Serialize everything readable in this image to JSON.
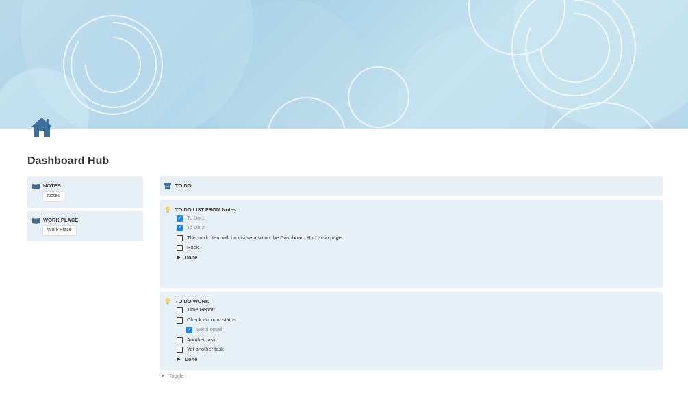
{
  "page": {
    "title": "Dashboard Hub",
    "icon": "house-icon",
    "cover_colors": [
      "#b9d9ea",
      "#a7d0e6",
      "#c4e2ef"
    ]
  },
  "sidebar": {
    "notes": {
      "title": "NOTES",
      "icon": "book-icon",
      "link_label": "Notes"
    },
    "work_place": {
      "title": "WORK PLACE",
      "icon": "book-icon",
      "link_label": "Work Place"
    }
  },
  "todo_header": {
    "title": "TO DO",
    "icon": "archive-box-icon"
  },
  "todo_notes": {
    "title": "TO DO LIST FROM Notes",
    "icon": "light-bulb-icon",
    "items": [
      {
        "label": "To Do 1",
        "checked": true
      },
      {
        "label": "To Do 2",
        "checked": true
      },
      {
        "label": "This to-do item will be visible also on the Dashboard Hub main page",
        "checked": false
      },
      {
        "label": "Rock",
        "checked": false
      }
    ],
    "done_label": "Done"
  },
  "todo_work": {
    "title": "TO DO WORK",
    "icon": "light-bulb-icon",
    "items": [
      {
        "label": "Time Report",
        "checked": false
      },
      {
        "label": "Check account status",
        "checked": false
      },
      {
        "label": "Send email",
        "checked": true
      },
      {
        "label": "Another task",
        "checked": false
      },
      {
        "label": "Yet another task",
        "checked": false
      }
    ],
    "done_label": "Done"
  },
  "toggle": {
    "label": "Toggle"
  },
  "colors": {
    "callout_bg": "#e7f0f6",
    "checkbox_checked": "#2383e2",
    "icon_blue": "#3d6f9c"
  }
}
